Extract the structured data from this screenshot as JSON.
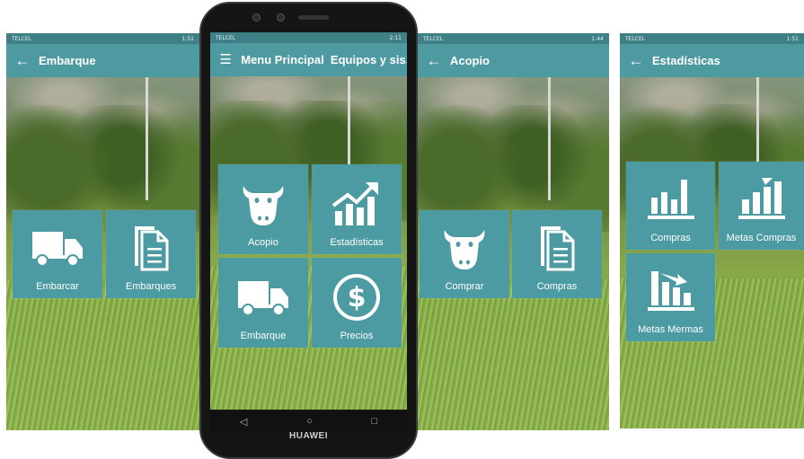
{
  "status": {
    "carrier": "TELCEL",
    "screen1_time": "1:51",
    "screen2_time": "2:11",
    "screen3_time": "1:44",
    "screen4_time": "1:51"
  },
  "phone": {
    "brand": "HUAWEI"
  },
  "screen1": {
    "title": "Embarque",
    "nav_icon": "back-arrow-icon",
    "tiles": [
      {
        "label": "Embarcar",
        "icon": "truck-icon"
      },
      {
        "label": "Embarques",
        "icon": "documents-icon"
      }
    ]
  },
  "screen2": {
    "title": "Menu Principal  Equipos y sis...",
    "nav_icon": "hamburger-menu-icon",
    "tiles": [
      {
        "label": "Acopio",
        "icon": "cow-icon"
      },
      {
        "label": "Estadísticas",
        "icon": "growth-chart-icon"
      },
      {
        "label": "Embarque",
        "icon": "truck-icon"
      },
      {
        "label": "Precios",
        "icon": "dollar-coin-icon"
      }
    ]
  },
  "screen3": {
    "title": "Acopio",
    "nav_icon": "back-arrow-icon",
    "tiles": [
      {
        "label": "Comprar",
        "icon": "cow-icon"
      },
      {
        "label": "Compras",
        "icon": "documents-icon"
      }
    ]
  },
  "screen4": {
    "title": "Estadísticas",
    "nav_icon": "back-arrow-icon",
    "tiles": [
      {
        "label": "Compras",
        "icon": "bar-chart-icon"
      },
      {
        "label": "Metas Compras",
        "icon": "bar-chart-up-icon"
      },
      {
        "label": "Metas Mermas",
        "icon": "bar-chart-down-icon"
      }
    ]
  },
  "colors": {
    "appbar": "#4e9aa1",
    "statusbar": "#3f7f86",
    "tile": "#4c9ba2"
  }
}
